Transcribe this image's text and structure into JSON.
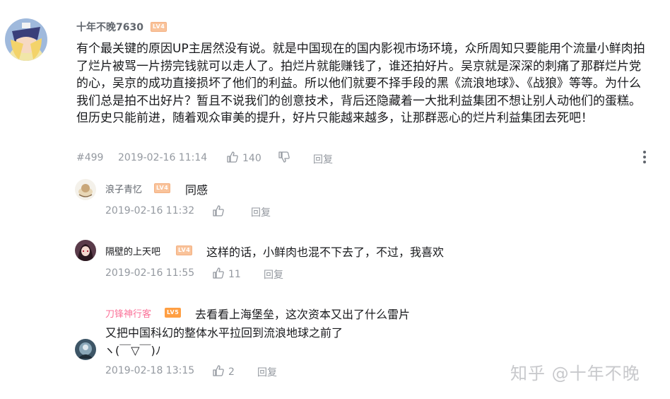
{
  "main_comment": {
    "username": "十年不晚7630",
    "level": "LV4",
    "text": "有个最关键的原因UP主居然没有说。就是中国现在的国内影视市场环境，众所周知只要能用个流量小鲜肉拍了烂片被骂一片捞完钱就可以走人了。拍烂片就能赚钱了，谁还拍好片。吴京就是深深的刺痛了那群烂片党的心，吴京的成功直接损坏了他们的利益。所以他们就要不择手段的黑《流浪地球》、《战狼》等等。为什么我们总是拍不出好片？暂且不说我们的创意技术，背后还隐藏着一大批利益集团不想让别人动他们的蛋糕。但历史只能前进，随着观众审美的提升，好片只能越来越多，让那群恶心的烂片利益集团去死吧！",
    "floor": "#499",
    "time": "2019-02-16 11:14",
    "likes": "140",
    "reply_label": "回复"
  },
  "replies": [
    {
      "username": "浪子青忆",
      "level": "LV4",
      "text": "同感",
      "time": "2019-02-16 11:32",
      "likes": "",
      "reply_label": "回复"
    },
    {
      "username": "隔壁的上天吧",
      "level": "LV4",
      "text": "这样的话，小鲜肉也混不下去了，不过，我喜欢",
      "time": "2019-02-16 11:55",
      "likes": "11",
      "reply_label": "回复"
    },
    {
      "username": "刀锋神行客",
      "level": "LV5",
      "text_line1": "去看看上海堡垒，这次资本又出了什么雷片",
      "text_line2": "又把中国科幻的整体水平拉回到流浪地球之前了",
      "text_line3": "ヽ(￣▽￣)ﾉ",
      "time": "2019-02-18 13:15",
      "likes": "2",
      "reply_label": "回复"
    }
  ],
  "watermark": "知乎 @十年不晚",
  "icons": {
    "like": "thumbs-up-icon",
    "dislike": "thumbs-down-icon",
    "more": "more-vertical-icon"
  },
  "colors": {
    "vip_name": "#fb7299",
    "meta": "#9499a0",
    "level_badge": "#f9c39b"
  }
}
